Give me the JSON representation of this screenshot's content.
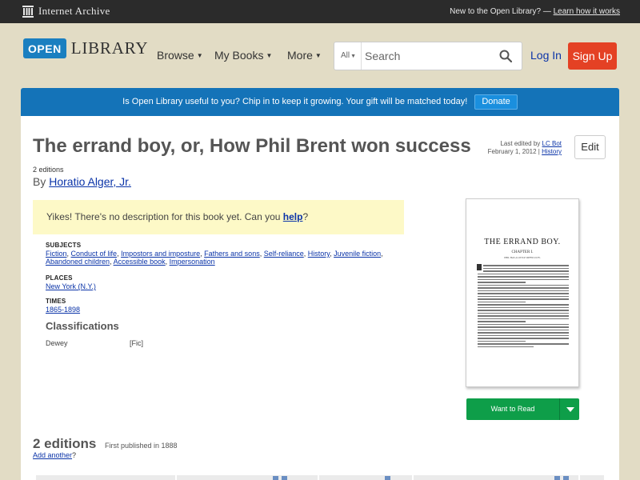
{
  "ia_bar": {
    "brand": "Internet Archive",
    "new_text": "New to the Open Library? —",
    "learn_link": "Learn how it works"
  },
  "header": {
    "logo_open": "OPEN",
    "logo_library": "LIBRARY",
    "nav": [
      "Browse",
      "My Books",
      "More"
    ],
    "search_scope": "All",
    "search_placeholder": "Search",
    "login": "Log In",
    "signup": "Sign Up"
  },
  "banner": {
    "text": "Is Open Library useful to you? Chip in to keep it growing. Your gift will be matched today!",
    "donate": "Donate"
  },
  "book": {
    "title": "The errand boy, or, How Phil Brent won success",
    "last_edited_prefix": "Last edited by",
    "last_edited_by": "LC Bot",
    "last_edited_date": "February 1, 2012 |",
    "history_link": "History",
    "edit_button": "Edit",
    "editions_count": "2 editions",
    "by": "By",
    "author": "Horatio Alger, Jr.",
    "no_desc_text": "Yikes! There's no description for this book yet. Can you",
    "help_link": "help",
    "no_desc_end": "?",
    "subjects_heading": "SUBJECTS",
    "subjects": [
      "Fiction",
      "Conduct of life",
      "Impostors and imposture",
      "Fathers and sons",
      "Self-reliance",
      "History",
      "Juvenile fiction",
      "Abandoned children",
      "Accessible book",
      "Impersonation"
    ],
    "places_heading": "PLACES",
    "places": [
      "New York (N.Y.)"
    ],
    "times_heading": "TIMES",
    "times": [
      "1865-1898"
    ],
    "classifications_heading": "Classifications",
    "dewey_label": "Dewey",
    "dewey_value": "[Fic]"
  },
  "cover": {
    "title": "THE ERRAND BOY.",
    "chapter": "CHAPTER I.",
    "subtitle": "PHIL HAS A LITTLE DIFFICULTY."
  },
  "actions": {
    "want_to_read": "Want to Read"
  },
  "editions": {
    "heading": "2 editions",
    "first_published": "First published in 1888",
    "add_another_link": "Add another",
    "add_another_suffix": "?"
  },
  "colors": {
    "ia_bar": "#2b2b2b",
    "page_bg": "#e2dcc5",
    "banner": "#1473b8",
    "signup": "#e44124",
    "want_to_read": "#0e9e49",
    "link": "#0b34a8"
  }
}
